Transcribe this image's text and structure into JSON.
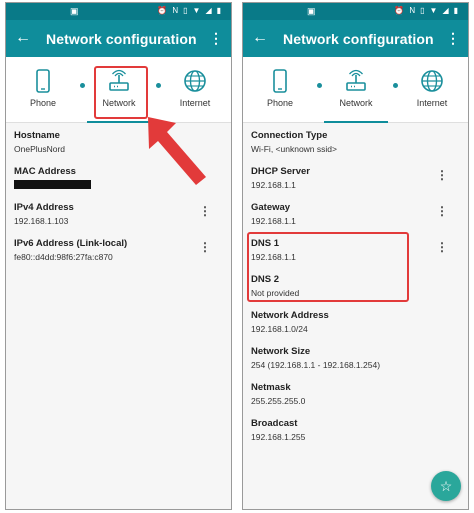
{
  "left": {
    "title": "Network configuration",
    "tabs": [
      {
        "label": "Phone"
      },
      {
        "label": "Network"
      },
      {
        "label": "Internet"
      }
    ],
    "details": [
      {
        "label": "Hostname",
        "value": "OnePlusNord"
      },
      {
        "label": "MAC Address",
        "value": ""
      },
      {
        "label": "IPv4 Address",
        "value": "192.168.1.103"
      },
      {
        "label": "IPv6 Address (Link-local)",
        "value": "fe80::d4dd:98f6:27fa:c870"
      }
    ]
  },
  "right": {
    "title": "Network configuration",
    "tabs": [
      {
        "label": "Phone"
      },
      {
        "label": "Network"
      },
      {
        "label": "Internet"
      }
    ],
    "details": [
      {
        "label": "Connection Type",
        "value": "Wi-Fi, <unknown ssid>"
      },
      {
        "label": "DHCP Server",
        "value": "192.168.1.1"
      },
      {
        "label": "Gateway",
        "value": "192.168.1.1"
      },
      {
        "label": "DNS 1",
        "value": "192.168.1.1"
      },
      {
        "label": "DNS 2",
        "value": "Not provided"
      },
      {
        "label": "Network Address",
        "value": "192.168.1.0/24"
      },
      {
        "label": "Network Size",
        "value": "254 (192.168.1.1 - 192.168.1.254)"
      },
      {
        "label": "Netmask",
        "value": "255.255.255.0"
      },
      {
        "label": "Broadcast",
        "value": "192.168.1.255"
      }
    ],
    "fab_icon": "star-icon"
  },
  "colors": {
    "statusbar": "#097a88",
    "appbar": "#0f8d9b",
    "highlight": "#e23a3a",
    "fab": "#2aa79b"
  },
  "icons": [
    "image-icon",
    "alarm-icon",
    "nfc-icon",
    "vibrate-icon",
    "wifi-icon",
    "signal-icon",
    "battery-icon",
    "back-arrow-icon",
    "overflow-menu-icon",
    "phone-icon",
    "router-icon",
    "globe-icon",
    "kebab-icon"
  ]
}
